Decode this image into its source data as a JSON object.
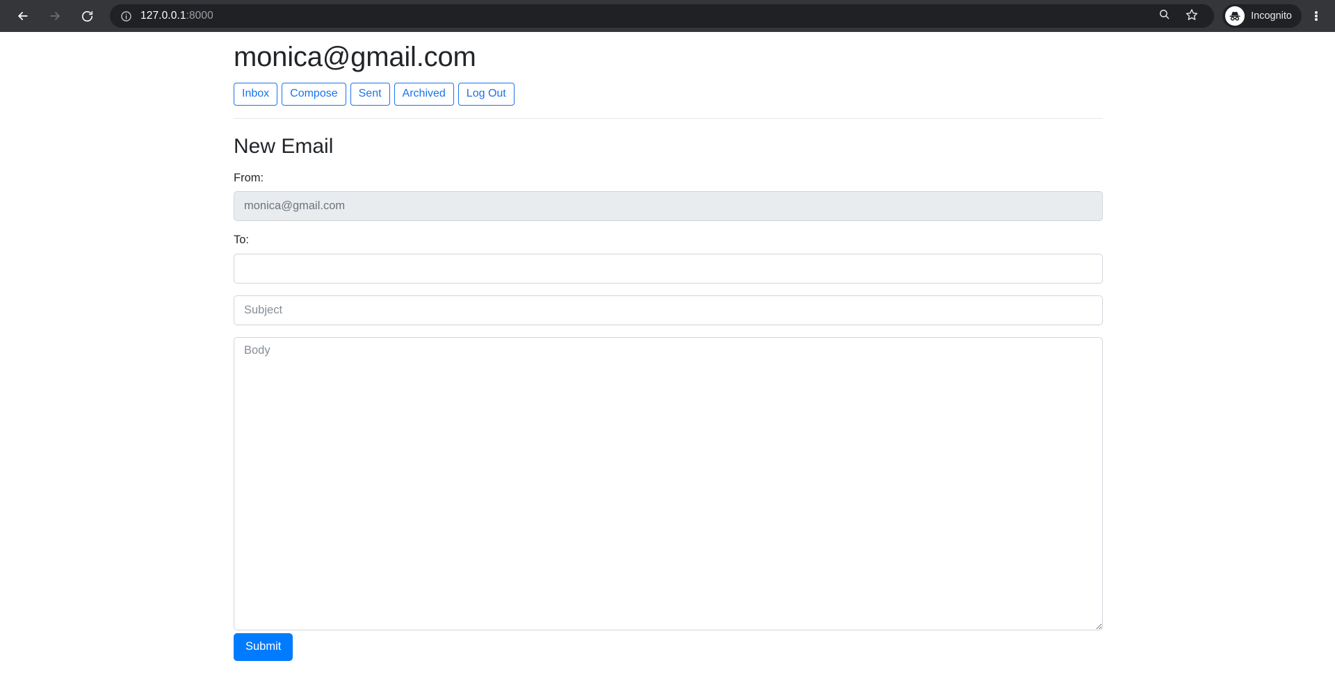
{
  "browser": {
    "back_icon": "back-arrow-icon",
    "forward_icon": "forward-arrow-icon",
    "reload_icon": "reload-icon",
    "site_info_icon": "site-info-icon",
    "url_host": "127.0.0.1",
    "url_port": ":8000",
    "url_full": "127.0.0.1:8000",
    "search_icon": "search-icon",
    "bookmark_icon": "star-icon",
    "profile_icon": "incognito-icon",
    "profile_label": "Incognito",
    "menu_icon": "kebab-menu-icon",
    "chrome_bg": "#35363a",
    "omnibox_bg": "#202124"
  },
  "page": {
    "user_email": "monica@gmail.com",
    "nav": [
      {
        "label": "Inbox",
        "name": "nav-inbox"
      },
      {
        "label": "Compose",
        "name": "nav-compose"
      },
      {
        "label": "Sent",
        "name": "nav-sent"
      },
      {
        "label": "Archived",
        "name": "nav-archived"
      },
      {
        "label": "Log Out",
        "name": "nav-logout"
      }
    ],
    "compose": {
      "title": "New Email",
      "from_label": "From:",
      "from_value": "monica@gmail.com",
      "to_label": "To:",
      "to_value": "",
      "to_placeholder": "",
      "subject_value": "",
      "subject_placeholder": "Subject",
      "body_value": "",
      "body_placeholder": "Body",
      "submit_label": "Submit"
    },
    "accent_color": "#007bff",
    "link_color": "#1a73e8",
    "disabled_bg": "#e9ecef"
  }
}
